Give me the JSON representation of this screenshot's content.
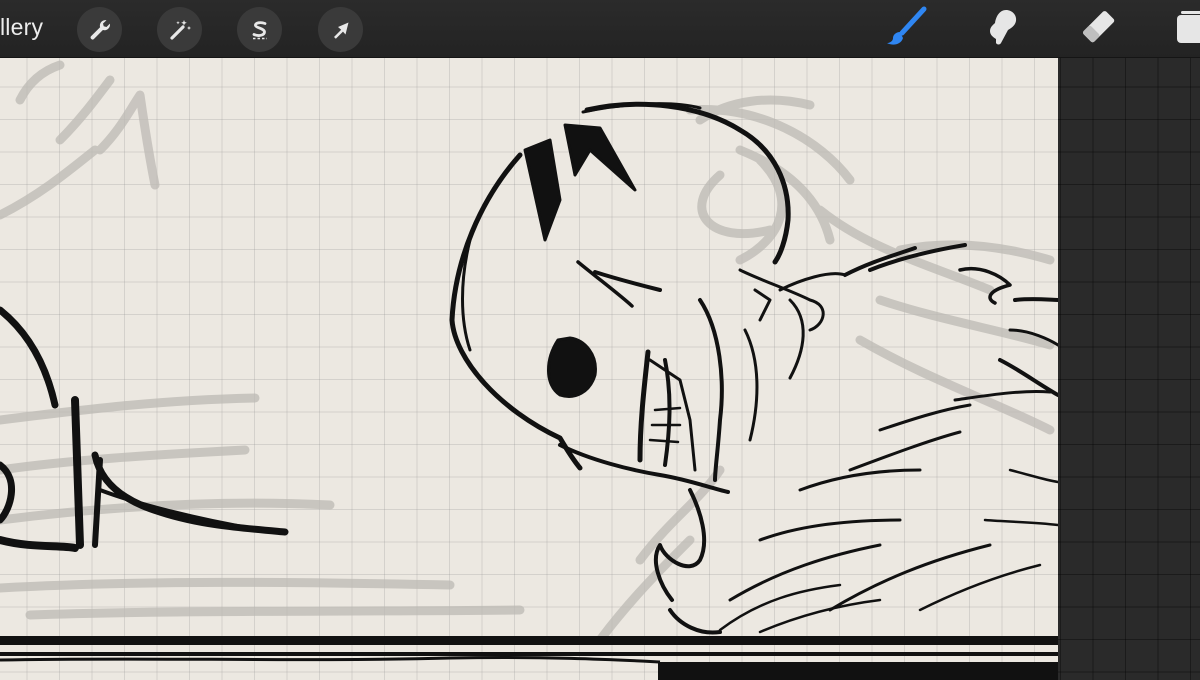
{
  "toolbar": {
    "gallery_label": "llery",
    "left_tools": [
      {
        "icon": "wrench-icon",
        "name": "actions"
      },
      {
        "icon": "magic-wand-icon",
        "name": "adjustments"
      },
      {
        "icon": "selection-s-icon",
        "name": "selection"
      },
      {
        "icon": "arrow-cursor-icon",
        "name": "transform"
      }
    ],
    "right_tools": [
      {
        "icon": "brush-icon",
        "name": "brush",
        "active": true
      },
      {
        "icon": "smudge-icon",
        "name": "smudge",
        "active": false
      },
      {
        "icon": "eraser-icon",
        "name": "eraser",
        "active": false
      },
      {
        "icon": "layers-icon",
        "name": "layers",
        "active": false
      }
    ]
  },
  "colors": {
    "toolbar_bg": "#262626",
    "tool_button_bg": "#3a3a3a",
    "active_tool": "#2f86f2",
    "inactive_tool": "#e6e6e6",
    "canvas_bg": "#ece8e1",
    "ink": "#111111",
    "sketch": "#bdbab4"
  }
}
